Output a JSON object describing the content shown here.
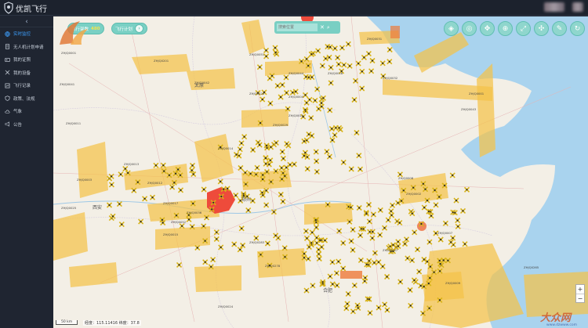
{
  "app": {
    "title": "优凯飞行"
  },
  "sidebar": {
    "collapse_icon": "chevron-left-icon",
    "items": [
      {
        "label": "实时监控",
        "icon": "globe-icon",
        "active": true
      },
      {
        "label": "无人机计划申请",
        "icon": "document-icon",
        "active": false
      },
      {
        "label": "我的证照",
        "icon": "id-card-icon",
        "active": false
      },
      {
        "label": "我的设备",
        "icon": "drone-icon",
        "active": false
      },
      {
        "label": "飞行记录",
        "icon": "flight-log-icon",
        "active": false
      },
      {
        "label": "政策、法规",
        "icon": "shield-icon",
        "active": false
      },
      {
        "label": "气象",
        "icon": "cloud-icon",
        "active": false
      },
      {
        "label": "公告",
        "icon": "megaphone-icon",
        "active": false
      }
    ]
  },
  "map": {
    "flight_count": {
      "label": "飞行架数",
      "value": "480"
    },
    "plan_button": {
      "label": "飞行计划"
    },
    "search": {
      "placeholder": "搜索位置",
      "value": ""
    },
    "toolbar_icons": [
      "layers-icon",
      "airspace-icon",
      "compass-icon",
      "target-icon",
      "fullscreen-icon",
      "measure-icon",
      "draw-icon",
      "refresh-icon"
    ],
    "zoom_in": "+",
    "zoom_out": "−",
    "scale": "50 km",
    "coords": "经度：115.11416 纬度：37.8",
    "cities": [
      {
        "name": "太原"
      },
      {
        "name": "西安"
      },
      {
        "name": "合肥"
      },
      {
        "name": "郑州"
      }
    ],
    "zones": [
      "ZHJQ0001",
      "ZHJQ0201",
      "ZHJQ0042",
      "ZHJQ0041",
      "ZHJQ0011",
      "ZHJQ0014",
      "ZHJQ0026",
      "ZHJQ0019",
      "ZHJQ0029",
      "ZHJQ0013",
      "ZHJQ0012",
      "ZHJQ0025",
      "ZHJQ0017",
      "ZHJQ0036",
      "ZHJQ0052",
      "ZHJQ0015",
      "ZHJQ0051",
      "ZHJQ0044",
      "ZHJQ0018",
      "ZHJQ0043",
      "ZHJQ0008",
      "ZHJQ0002",
      "ZHJQ0007",
      "ZHJQ0047",
      "ZHJQ0009",
      "ZHJQ0265",
      "ZHJQ0283",
      "ZHJQ0278",
      "ZHJQ0024",
      "ZHJQ0031",
      "ZHJQ0032",
      "ZHJQ0001",
      "ZHJQ0003",
      "ZHJQ0004"
    ],
    "watermark": {
      "text": "大众网",
      "url": "www.dzwww.com"
    }
  }
}
